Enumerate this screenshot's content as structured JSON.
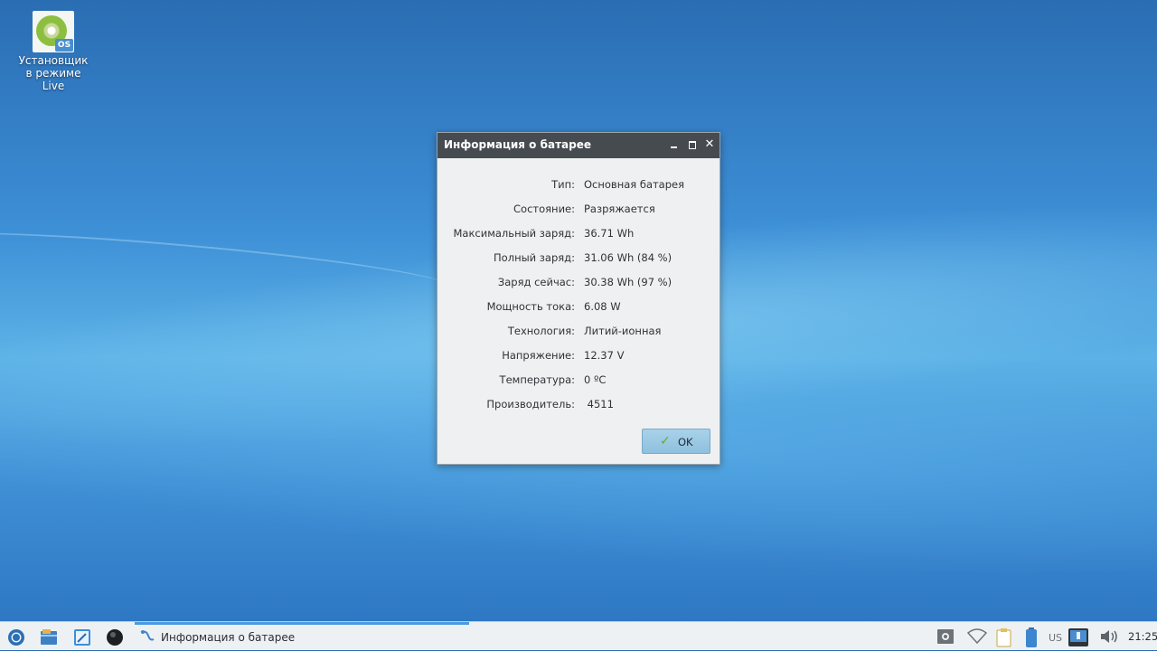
{
  "desktop": {
    "icons": [
      {
        "label_line1": "Установщик",
        "label_line2": "в режиме",
        "label_line3": "Live",
        "badge": "OS"
      }
    ]
  },
  "dialog": {
    "title": "Информация о батарее",
    "rows": [
      {
        "key": "Тип:",
        "value": "Основная батарея"
      },
      {
        "key": "Состояние:",
        "value": "Разряжается"
      },
      {
        "key": "Максимальный заряд:",
        "value": "36.71 Wh"
      },
      {
        "key": "Полный заряд:",
        "value": "31.06 Wh (84 %)"
      },
      {
        "key": "Заряд сейчас:",
        "value": "30.38 Wh (97 %)"
      },
      {
        "key": "Мощность тока:",
        "value": "6.08 W"
      },
      {
        "key": "Технология:",
        "value": "Литий-ионная"
      },
      {
        "key": "Напряжение:",
        "value": "12.37 V"
      },
      {
        "key": "Температура:",
        "value": "0 ºC"
      },
      {
        "key": "Производитель:",
        "value": " 4511"
      }
    ],
    "ok_label": "OK"
  },
  "taskbar": {
    "task_label": "Информация о батарее",
    "keyboard_layout": "US",
    "clock": "21:25",
    "icons": [
      "start-menu-icon",
      "file-manager-icon",
      "text-editor-icon",
      "web-browser-icon"
    ]
  },
  "colors": {
    "titlebar": "#464b50",
    "dialog_bg": "#eef0f1",
    "ok_button": "#9bc8e4",
    "taskbar_bg": "#eef1f3",
    "task_indicator": "#4a9be0"
  }
}
